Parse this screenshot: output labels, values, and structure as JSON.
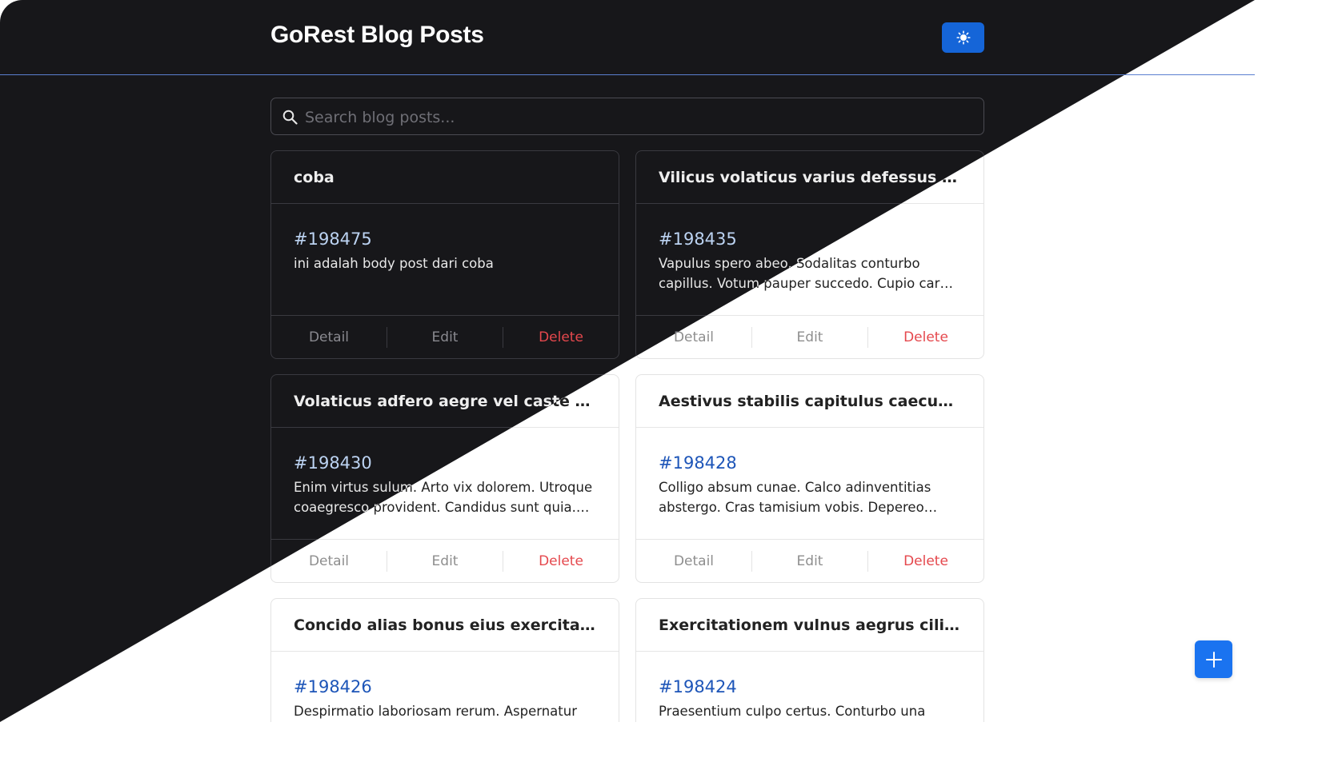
{
  "header": {
    "title": "GoRest Blog Posts",
    "theme_toggle_icon": "sun-icon"
  },
  "search": {
    "placeholder": "Search blog posts...",
    "icon": "search-icon"
  },
  "actions": {
    "detail": "Detail",
    "edit": "Edit",
    "delete": "Delete"
  },
  "posts": [
    {
      "title": "coba",
      "id": "#198475",
      "body": "ini adalah body post dari coba"
    },
    {
      "title": "Vilicus volaticus varius defessus delinquo ...",
      "id": "#198435",
      "body": "Vapulus spero abeo. Sodalitas conturbo capillus. Votum pauper succedo. Cupio carbo cohaero...."
    },
    {
      "title": "Volaticus adfero aegre vel caste suggero.",
      "id": "#198430",
      "body": "Enim virtus sulum. Arto vix dolorem. Utroque coaegresco provident. Candidus sunt quia. Conor..."
    },
    {
      "title": "Aestivus stabilis capitulus caecus necessita...",
      "id": "#198428",
      "body": "Colligo absum cunae. Calco adinventitias abstergo. Cras tamisium vobis. Depereo voluptas demonstro..."
    },
    {
      "title": "Concido alias bonus eius exercitationem et.",
      "id": "#198426",
      "body": "Despirmatio laboriosam rerum. Aspernatur"
    },
    {
      "title": "Exercitationem vulnus aegrus cilicium coh...",
      "id": "#198424",
      "body": "Praesentium culpo certus. Conturbo una beatus."
    }
  ],
  "fab": {
    "icon": "plus-icon"
  },
  "colors": {
    "accent": "#1565d8",
    "delete": "#e5484d",
    "dark_bg": "#17171a",
    "light_bg": "#ffffff"
  }
}
